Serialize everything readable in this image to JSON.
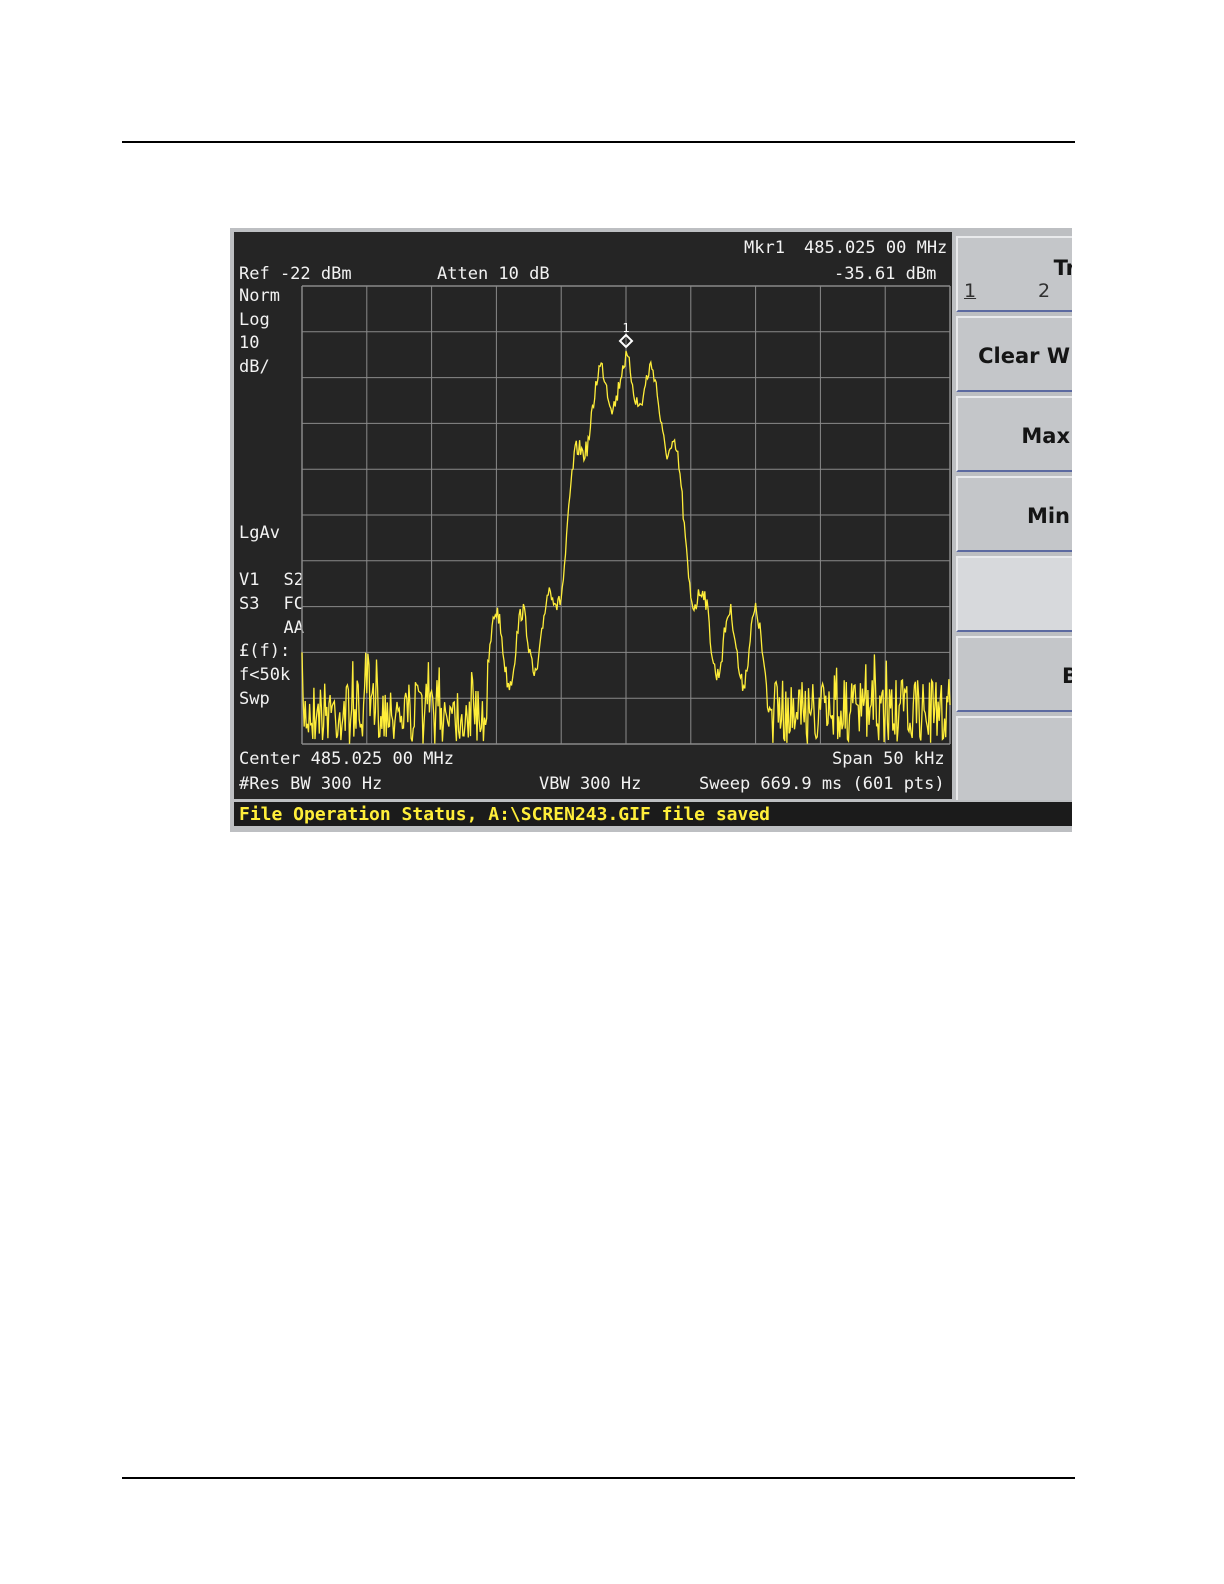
{
  "screen": {
    "marker_label": "Mkr1",
    "marker_freq": "485.025 00 MHz",
    "ref_level": "Ref -22 dBm",
    "attenuation": "Atten 10 dB",
    "marker_amplitude": "-35.61 dBm",
    "side_labels": {
      "norm": "Norm",
      "log": "Log",
      "scale_value": "10",
      "scale_unit": "dB/",
      "lgav": "LgAv",
      "v1": "V1",
      "s2": "S2",
      "s3": "S3",
      "fc": "FC",
      "aa": "AA",
      "ef": "£(f):",
      "flt": "f<50k",
      "swp": "Swp"
    },
    "center_freq": "Center 485.025 00 MHz",
    "span": "Span 50 kHz",
    "res_bw": "#Res BW 300 Hz",
    "vbw": "VBW 300 Hz",
    "sweep": "Sweep 669.9 ms (601 pts)",
    "marker_number": "1",
    "trace_color": "#ffee3a",
    "grid_color": "#8a8a8a"
  },
  "status_bar": {
    "text": "File Operation Status, A:\\SCREN243.GIF file saved"
  },
  "softkeys": {
    "trace_title": "Tr",
    "trace_1": "1",
    "trace_2": "2",
    "clear": "Clear W",
    "max": "Max",
    "min": "Min",
    "blank": "",
    "view": "B"
  }
}
